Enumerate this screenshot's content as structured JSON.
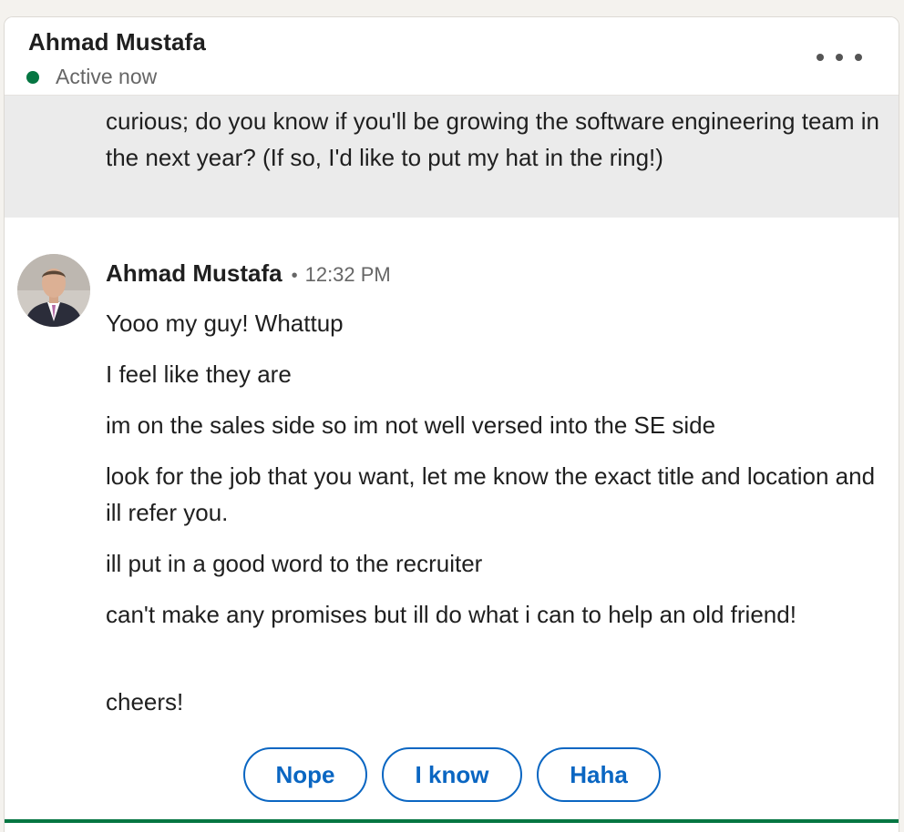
{
  "header": {
    "name": "Ahmad Mustafa",
    "status": "Active now",
    "status_color": "#057642",
    "more_icon": "more-horizontal-icon"
  },
  "previous_message": {
    "text": "curious; do you know if you'll be growing the software engineering team in the next year? (If so, I'd like to put my hat in the ring!)"
  },
  "message_group": {
    "sender": "Ahmad Mustafa",
    "separator": "•",
    "time": "12:32 PM",
    "messages": [
      "Yooo my guy! Whattup",
      "I feel like they are",
      "im on the sales side so im not well versed into the SE side",
      "look for the job that you want, let me know the exact title and location and ill refer you.",
      "ill put in a good word to the recruiter",
      "can't make any promises but ill do what i can to help an old friend!",
      "cheers!"
    ]
  },
  "quick_replies": [
    "Nope",
    "I know",
    "Haha"
  ],
  "accent_color": "#0a66c2"
}
